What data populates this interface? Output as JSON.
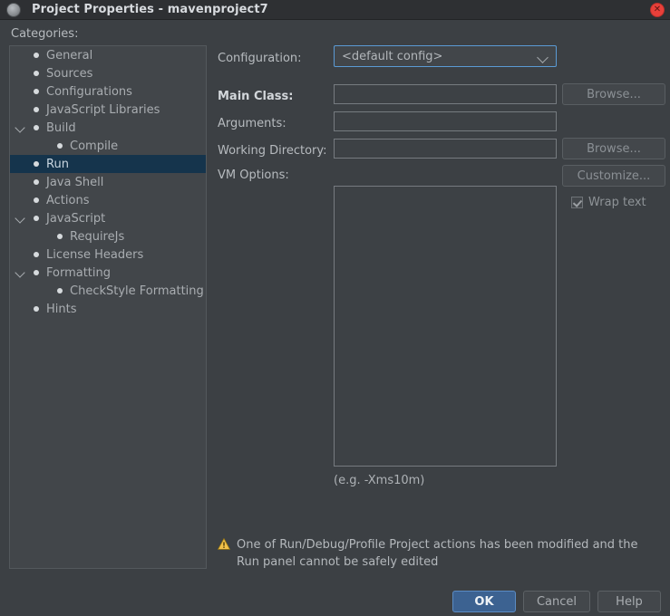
{
  "window": {
    "title": "Project Properties - mavenproject7",
    "app_icon": "window-menu-icon",
    "close_icon": "✕"
  },
  "sidebar": {
    "label": "Categories:",
    "items": [
      {
        "label": "General",
        "indent": 0,
        "expander": false,
        "selected": false
      },
      {
        "label": "Sources",
        "indent": 0,
        "expander": false,
        "selected": false
      },
      {
        "label": "Configurations",
        "indent": 0,
        "expander": false,
        "selected": false
      },
      {
        "label": "JavaScript Libraries",
        "indent": 0,
        "expander": false,
        "selected": false
      },
      {
        "label": "Build",
        "indent": 0,
        "expander": true,
        "selected": false
      },
      {
        "label": "Compile",
        "indent": 1,
        "expander": false,
        "selected": false
      },
      {
        "label": "Run",
        "indent": 0,
        "expander": false,
        "selected": true
      },
      {
        "label": "Java Shell",
        "indent": 0,
        "expander": false,
        "selected": false
      },
      {
        "label": "Actions",
        "indent": 0,
        "expander": false,
        "selected": false
      },
      {
        "label": "JavaScript",
        "indent": 0,
        "expander": true,
        "selected": false
      },
      {
        "label": "RequireJs",
        "indent": 1,
        "expander": false,
        "selected": false
      },
      {
        "label": "License Headers",
        "indent": 0,
        "expander": false,
        "selected": false
      },
      {
        "label": "Formatting",
        "indent": 0,
        "expander": true,
        "selected": false
      },
      {
        "label": "CheckStyle Formatting",
        "indent": 1,
        "expander": false,
        "selected": false
      },
      {
        "label": "Hints",
        "indent": 0,
        "expander": false,
        "selected": false
      }
    ]
  },
  "form": {
    "configuration": {
      "label": "Configuration:",
      "value": "<default config>",
      "chevron_icon": "chevron-down-icon"
    },
    "main_class": {
      "label": "Main Class:",
      "value": "",
      "browse_label": "Browse..."
    },
    "arguments": {
      "label": "Arguments:",
      "value": ""
    },
    "working_directory": {
      "label": "Working Directory:",
      "value": "",
      "browse_label": "Browse..."
    },
    "vm_options": {
      "label": "VM Options:",
      "value": "",
      "customize_label": "Customize...",
      "wrap_text_label": "Wrap text",
      "wrap_text_checked": true,
      "hint": "(e.g. -Xms10m)"
    }
  },
  "warning": {
    "icon": "warning-triangle-icon",
    "line1": "One of Run/Debug/Profile Project actions has been modified and the",
    "line2": "Run panel cannot be safely edited"
  },
  "buttons": {
    "ok": "OK",
    "cancel": "Cancel",
    "help": "Help"
  },
  "colors": {
    "window_bg": "#3c4044",
    "titlebar_bg": "#2e3033",
    "panel_bg": "#42464a",
    "selection_bg": "#15344c",
    "focus_border": "#5b9bd5",
    "primary_button": "#3c6291",
    "close_button": "#e8403a",
    "warning_yellow": "#f2c14b"
  }
}
